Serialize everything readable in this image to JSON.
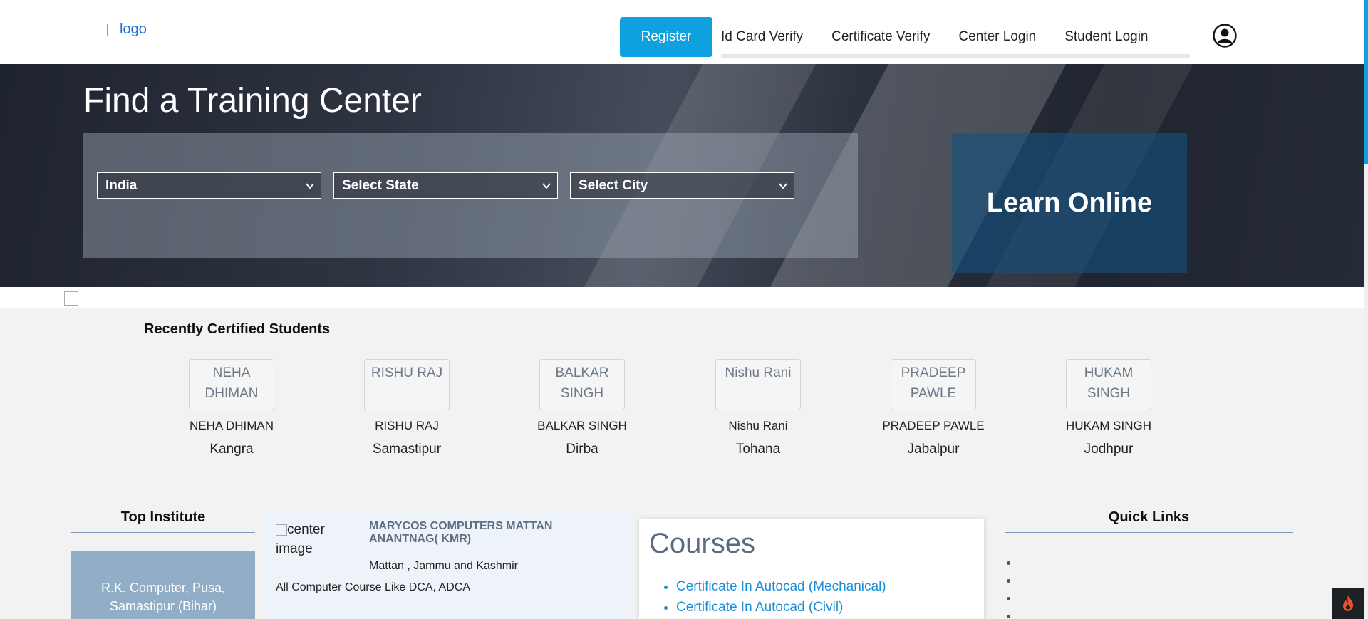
{
  "header": {
    "logo_alt": "logo",
    "register_label": "Register",
    "nav_links": [
      "Id Card Verify",
      "Certificate Verify",
      "Center Login",
      "Student Login"
    ]
  },
  "hero": {
    "title": "Find a Training Center",
    "country_select": "India",
    "state_select": "Select State",
    "city_select": "Select City",
    "learn_online": "Learn Online"
  },
  "students_section": {
    "title": "Recently Certified Students",
    "students": [
      {
        "photo_alt": "NEHA DHIMAN",
        "name": "NEHA DHIMAN",
        "city": "Kangra"
      },
      {
        "photo_alt": "RISHU RAJ",
        "name": "RISHU RAJ",
        "city": "Samastipur"
      },
      {
        "photo_alt": "BALKAR SINGH",
        "name": "BALKAR SINGH",
        "city": "Dirba"
      },
      {
        "photo_alt": "Nishu Rani",
        "name": "Nishu Rani",
        "city": "Tohana"
      },
      {
        "photo_alt": "PRADEEP PAWLE",
        "name": "PRADEEP PAWLE",
        "city": "Jabalpur"
      },
      {
        "photo_alt": "HUKAM SINGH",
        "name": "HUKAM SINGH",
        "city": "Jodhpur"
      }
    ]
  },
  "top_institute": {
    "title": "Top Institute",
    "item": "R.K. Computer, Pusa, Samastipur (Bihar)"
  },
  "center": {
    "image_alt": "center image",
    "name": "MARYCOS COMPUTERS MATTAN ANANTNAG( KMR)",
    "location": "Mattan , Jammu and Kashmir",
    "description": "All Computer Course Like DCA, ADCA"
  },
  "courses": {
    "title": "Courses",
    "items": [
      "Certificate In Autocad (Mechanical)",
      "Certificate In Autocad (Civil)"
    ]
  },
  "quick_links": {
    "title": "Quick Links"
  },
  "colors": {
    "accent": "#0ea0df",
    "link": "#1a8fd8"
  }
}
